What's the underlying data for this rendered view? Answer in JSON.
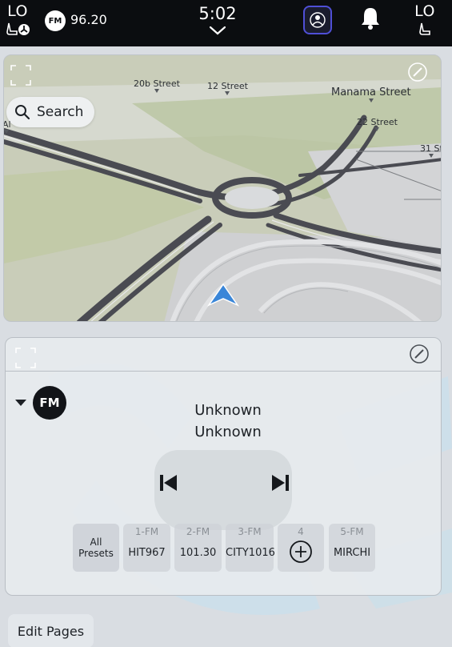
{
  "status_bar": {
    "temp_left": "LO",
    "temp_right": "LO",
    "source_badge": "FM",
    "frequency": "96.20",
    "time": "5:02"
  },
  "map": {
    "search_label": "Search",
    "streets": [
      "20b Street",
      "12 Street",
      "Manama Street",
      "22 Street",
      "31 St",
      "Al"
    ]
  },
  "radio": {
    "source_badge": "FM",
    "track_title": "Unknown",
    "track_artist": "Unknown",
    "presets": [
      {
        "num": "",
        "name": "All\nPresets"
      },
      {
        "num": "1-FM",
        "name": "HIT967"
      },
      {
        "num": "2-FM",
        "name": "101.30"
      },
      {
        "num": "3-FM",
        "name": "CITY1016"
      },
      {
        "num": "4",
        "name": ""
      },
      {
        "num": "5-FM",
        "name": "MIRCHI"
      }
    ],
    "preset_all_line1": "All",
    "preset_all_line2": "Presets"
  },
  "bottom": {
    "edit_pages_label": "Edit Pages"
  },
  "colors": {
    "status_bg": "#0b0d10",
    "accent_nav": "#3a86d8",
    "driver_ring": "#4f4fd6",
    "watermark": "#bfe3f3"
  }
}
